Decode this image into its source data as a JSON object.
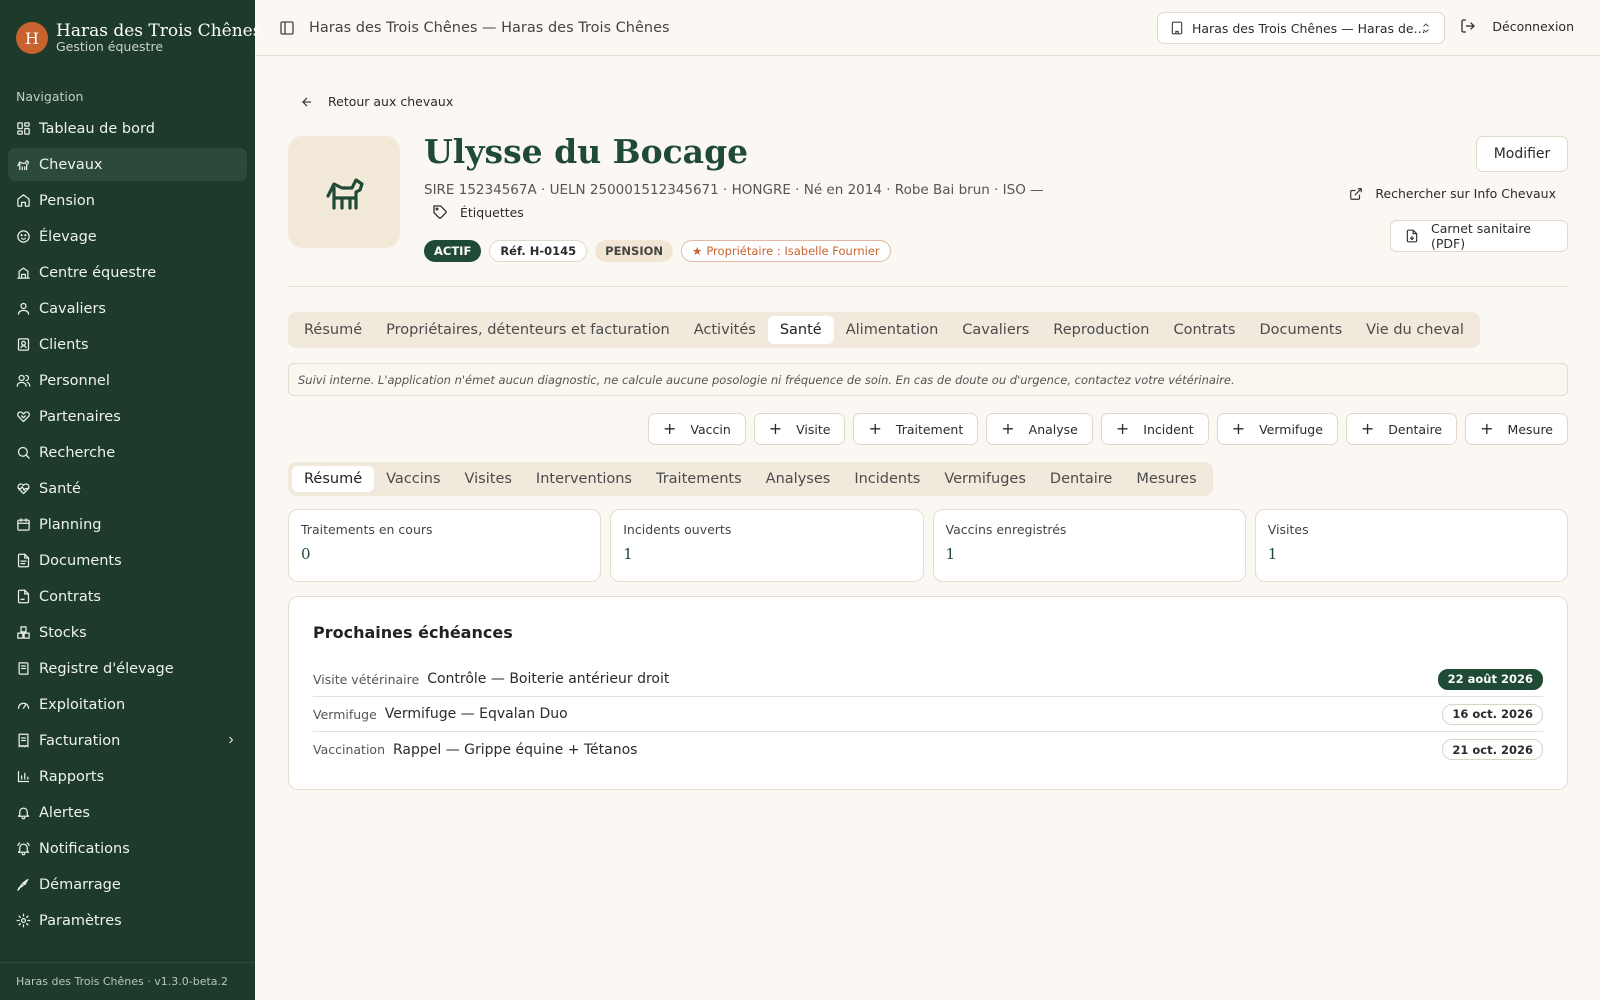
{
  "brand": {
    "initial": "H",
    "name": "Haras des Trois Chênes",
    "subtitle": "Gestion équestre"
  },
  "nav_heading": "Navigation",
  "nav": [
    {
      "label": "Tableau de bord",
      "icon": "dashboard-icon"
    },
    {
      "label": "Chevaux",
      "icon": "horse-icon",
      "active": true
    },
    {
      "label": "Pension",
      "icon": "home-icon"
    },
    {
      "label": "Élevage",
      "icon": "baby-icon"
    },
    {
      "label": "Centre équestre",
      "icon": "school-icon"
    },
    {
      "label": "Cavaliers",
      "icon": "user-icon"
    },
    {
      "label": "Clients",
      "icon": "contact-icon"
    },
    {
      "label": "Personnel",
      "icon": "users-icon"
    },
    {
      "label": "Partenaires",
      "icon": "handshake-icon"
    },
    {
      "label": "Recherche",
      "icon": "search-icon"
    },
    {
      "label": "Santé",
      "icon": "heart-pulse-icon"
    },
    {
      "label": "Planning",
      "icon": "calendar-icon"
    },
    {
      "label": "Documents",
      "icon": "file-icon"
    },
    {
      "label": "Contrats",
      "icon": "contract-icon"
    },
    {
      "label": "Stocks",
      "icon": "boxes-icon"
    },
    {
      "label": "Registre d'élevage",
      "icon": "register-icon"
    },
    {
      "label": "Exploitation",
      "icon": "gauge-icon"
    },
    {
      "label": "Facturation",
      "icon": "receipt-icon",
      "expandable": true
    },
    {
      "label": "Rapports",
      "icon": "bar-chart-icon"
    },
    {
      "label": "Alertes",
      "icon": "bell-icon"
    },
    {
      "label": "Notifications",
      "icon": "bell-ring-icon"
    },
    {
      "label": "Démarrage",
      "icon": "rocket-icon"
    },
    {
      "label": "Paramètres",
      "icon": "gear-icon"
    }
  ],
  "footer": "Haras des Trois Chênes · v1.3.0-beta.2",
  "topbar": {
    "title": "Haras des Trois Chênes — Haras des Trois Chênes",
    "org_select": "Haras des Trois Chênes — Haras de...",
    "logout": "Déconnexion"
  },
  "back_link": "Retour aux chevaux",
  "horse": {
    "name": "Ulysse du Bocage",
    "meta": "SIRE 15234567A · UELN 250001512345671 · HONGRE · Né en 2014 · Robe Bai brun · ISO —",
    "tags_label": "Étiquettes",
    "badges": {
      "status": "ACTIF",
      "ref": "Réf. H-0145",
      "type": "PENSION",
      "owner": "Propriétaire : Isabelle Fournier"
    }
  },
  "header_actions": {
    "edit": "Modifier",
    "info_chevaux": "Rechercher sur Info Chevaux",
    "carnet": "Carnet sanitaire (PDF)"
  },
  "tabs": [
    "Résumé",
    "Propriétaires, détenteurs et facturation",
    "Activités",
    "Santé",
    "Alimentation",
    "Cavaliers",
    "Reproduction",
    "Contrats",
    "Documents",
    "Vie du cheval"
  ],
  "active_tab": "Santé",
  "disclaimer": "Suivi interne. L'application n'émet aucun diagnostic, ne calcule aucune posologie ni fréquence de soin. En cas de doute ou d'urgence, contactez votre vétérinaire.",
  "add_actions": [
    "Vaccin",
    "Visite",
    "Traitement",
    "Analyse",
    "Incident",
    "Vermifuge",
    "Dentaire",
    "Mesure"
  ],
  "subtabs": [
    "Résumé",
    "Vaccins",
    "Visites",
    "Interventions",
    "Traitements",
    "Analyses",
    "Incidents",
    "Vermifuges",
    "Dentaire",
    "Mesures"
  ],
  "active_subtab": "Résumé",
  "stats": [
    {
      "label": "Traitements en cours",
      "value": "0"
    },
    {
      "label": "Incidents ouverts",
      "value": "1"
    },
    {
      "label": "Vaccins enregistrés",
      "value": "1"
    },
    {
      "label": "Visites",
      "value": "1"
    }
  ],
  "deadlines": {
    "title": "Prochaines échéances",
    "items": [
      {
        "type": "Visite vétérinaire",
        "label": "Contrôle — Boiterie antérieur droit",
        "date": "22 août 2026",
        "highlight": true
      },
      {
        "type": "Vermifuge",
        "label": "Vermifuge — Eqvalan Duo",
        "date": "16 oct. 2026"
      },
      {
        "type": "Vaccination",
        "label": "Rappel — Grippe équine + Tétanos",
        "date": "21 oct. 2026"
      }
    ]
  },
  "colors": {
    "sidebar_bg": "#1d3a2b",
    "accent": "#1f4a35",
    "brand": "#c8632f",
    "page_bg": "#fbf8f3"
  }
}
